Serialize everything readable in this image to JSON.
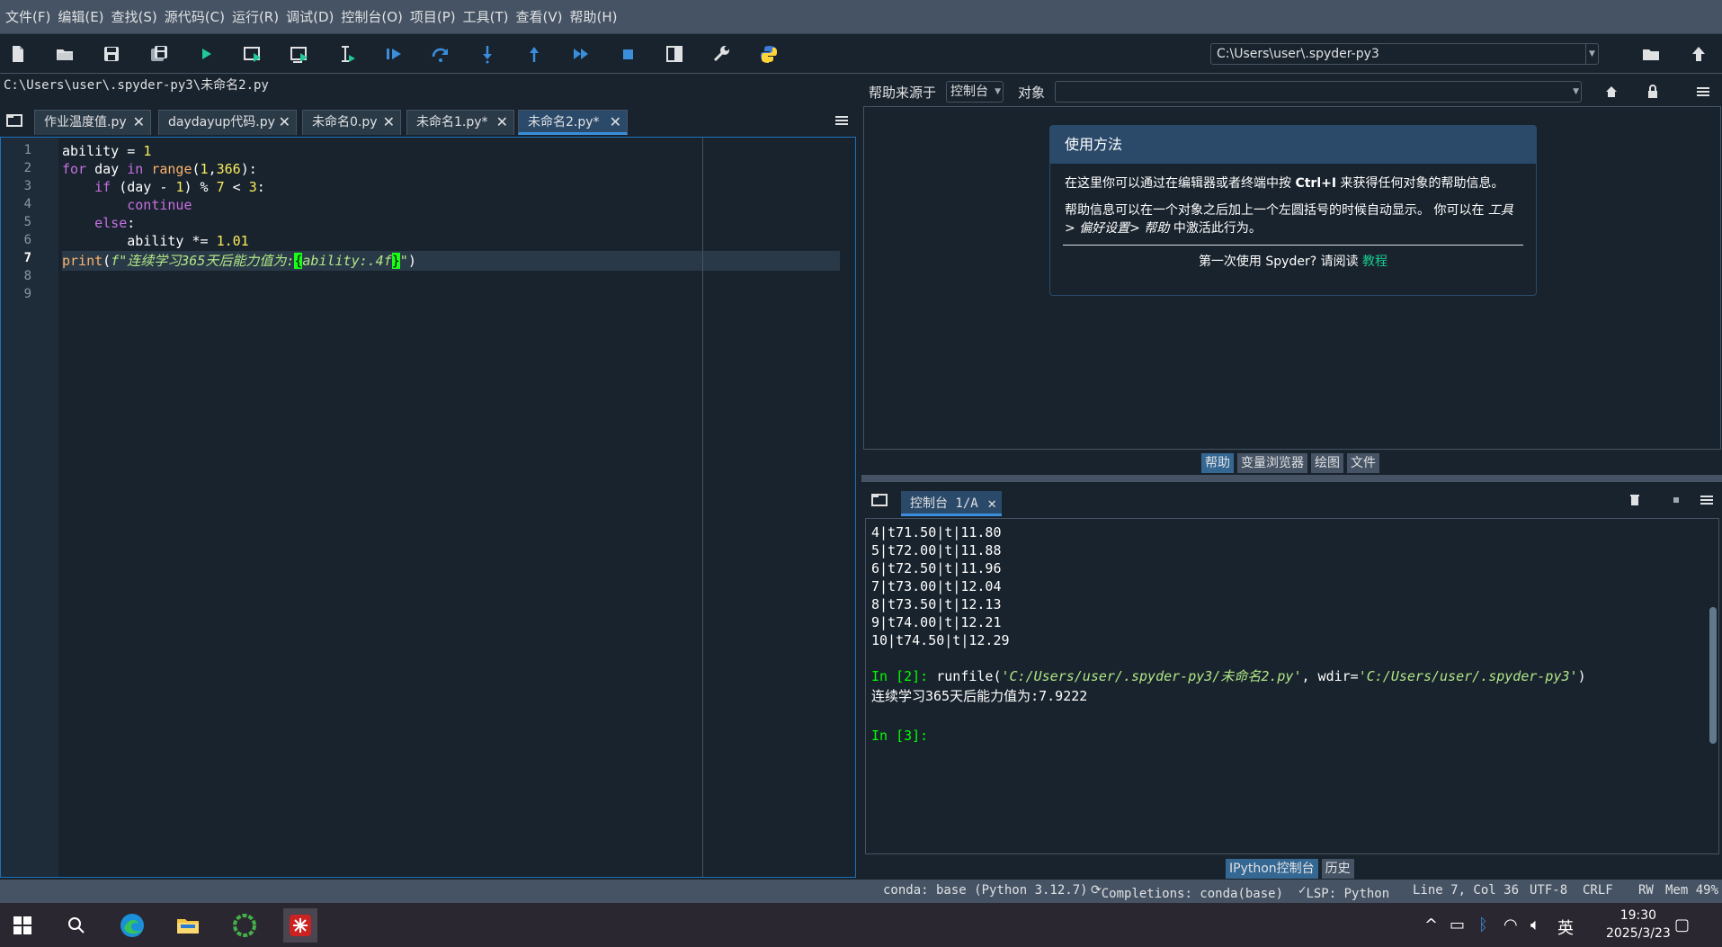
{
  "menubar": {
    "items": [
      "文件(F)",
      "编辑(E)",
      "查找(S)",
      "源代码(C)",
      "运行(R)",
      "调试(D)",
      "控制台(O)",
      "项目(P)",
      "工具(T)",
      "查看(V)",
      "帮助(H)"
    ]
  },
  "toolbar": {
    "icons": [
      "new-file-icon",
      "open-file-icon",
      "save-icon",
      "save-all-icon",
      "run-icon",
      "run-cell-icon",
      "run-cell-advance-icon",
      "run-selection-icon",
      "debug-icon",
      "step-icon",
      "step-into-icon",
      "step-return-icon",
      "continue-icon",
      "stop-icon",
      "maximize-pane-icon",
      "preferences-icon",
      "python-path-icon"
    ],
    "working_dir": "C:\\Users\\user\\.spyder-py3"
  },
  "editor": {
    "file_path": "C:\\Users\\user\\.spyder-py3\\未命名2.py",
    "tabs": [
      {
        "label": "作业温度值.py",
        "active": false
      },
      {
        "label": "daydayup代码.py",
        "active": false
      },
      {
        "label": "未命名0.py",
        "active": false
      },
      {
        "label": "未命名1.py*",
        "active": false
      },
      {
        "label": "未命名2.py*",
        "active": true
      }
    ],
    "line_numbers": [
      "1",
      "2",
      "3",
      "4",
      "5",
      "6",
      "7",
      "8",
      "9"
    ],
    "current_line": "7",
    "code": {
      "l1": {
        "a": "ability = ",
        "b": "1"
      },
      "l2": {
        "a": "for",
        "b": " day ",
        "c": "in",
        "d": " range",
        "e": "(",
        "f": "1",
        "g": ",",
        "h": "366",
        "i": "):"
      },
      "l3": {
        "a": "    ",
        "b": "if",
        "c": " (day - ",
        "d": "1",
        "e": ") % ",
        "f": "7",
        "g": " < ",
        "h": "3",
        "i": ":"
      },
      "l4": {
        "a": "        ",
        "b": "continue"
      },
      "l5": {
        "a": "    ",
        "b": "else",
        "c": ":"
      },
      "l6": {
        "a": "        ability *= ",
        "b": "1.01"
      },
      "l7": {
        "a": "print",
        "b": "(",
        "c": "f\"连续学习365天后能力值为:",
        "d": "{",
        "e": "ability:.4f",
        "f": "}",
        "g": "\"",
        "h": ")"
      }
    }
  },
  "help": {
    "source_label": "帮助来源于",
    "source_value": "控制台",
    "object_label": "对象",
    "object_value": "",
    "usage_title": "使用方法",
    "p1_a": "在这里你可以通过在编辑器或者终端中按 ",
    "p1_key": "Ctrl+I",
    "p1_b": " 来获得任何对象的帮助信息。",
    "p2_a": "帮助信息可以在一个对象之后加上一个左圆括号的时候自动显示。 你可以在 ",
    "p2_path": "工具> 偏好设置> 帮助",
    "p2_b": " 中激活此行为。",
    "footer_a": "第一次使用 Spyder? 请阅读 ",
    "footer_link": "教程",
    "tabs": [
      "帮助",
      "变量浏览器",
      "绘图",
      "文件"
    ]
  },
  "console": {
    "tab_label": "控制台 1/A",
    "output_lines": [
      "4|t71.50|t|11.80",
      "5|t72.00|t|11.88",
      "6|t72.50|t|11.96",
      "7|t73.00|t|12.04",
      "8|t73.50|t|12.13",
      "9|t74.00|t|12.21",
      "10|t74.50|t|12.29"
    ],
    "in2_prompt": "In [2]:",
    "in2_a": " runfile(",
    "in2_file": "'C:/Users/user/.spyder-py3/未命名2.py'",
    "in2_b": ", wdir=",
    "in2_wdir": "'C:/Users/user/.spyder-py3'",
    "in2_c": ")",
    "result": "连续学习365天后能力值为:7.9222",
    "in3_prompt": "In [3]:",
    "tabs": [
      "IPython控制台",
      "历史"
    ]
  },
  "statusbar": {
    "env": "conda: base (Python 3.12.7)",
    "completions": "Completions: conda(base)",
    "lsp": "LSP: Python",
    "position": "Line 7, Col 36",
    "encoding": "UTF-8",
    "eol": "CRLF",
    "rw": "RW",
    "mem": "Mem 49%"
  },
  "taskbar": {
    "ime": "英",
    "time": "19:30",
    "date": "2025/3/23"
  }
}
